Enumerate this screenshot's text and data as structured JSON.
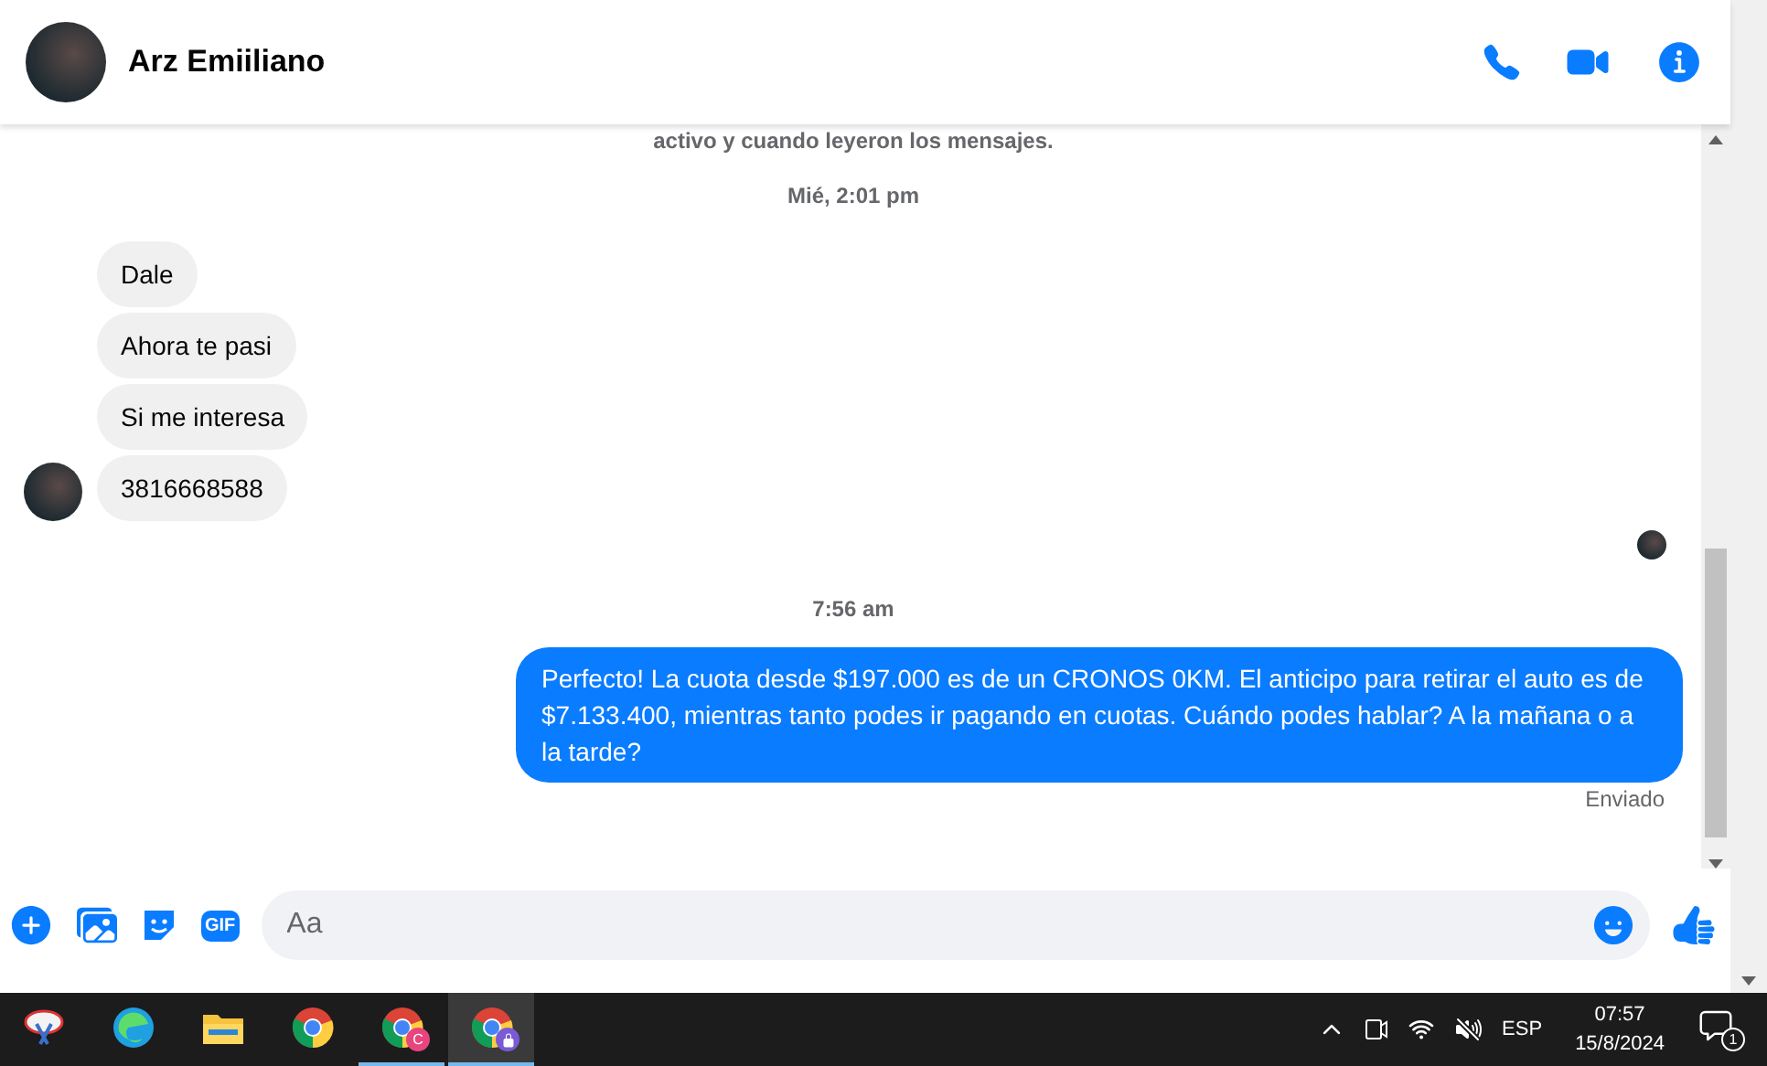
{
  "conversation": {
    "name": "Arz Emiiliano"
  },
  "messages": [
    {
      "kind": "notice",
      "text": "activo y cuando leyeron los mensajes."
    },
    {
      "kind": "time",
      "text": "Mié, 2:01 pm"
    },
    {
      "kind": "received",
      "text": "Dale",
      "avatar": false
    },
    {
      "kind": "received",
      "text": "Ahora te pasi",
      "avatar": false
    },
    {
      "kind": "received",
      "text": "Si me interesa",
      "avatar": false
    },
    {
      "kind": "received",
      "text": "3816668588",
      "avatar": true
    },
    {
      "kind": "seen"
    },
    {
      "kind": "time",
      "text": "7:56 am"
    },
    {
      "kind": "sent",
      "text": "Perfecto! La cuota desde $197.000 es de un CRONOS 0KM. El anticipo para retirar el auto es de $7.133.400, mientras tanto podes ir pagando en cuotas. Cuándo podes hablar? A la mañana o a la tarde?"
    },
    {
      "kind": "status",
      "text": "Enviado"
    }
  ],
  "composer": {
    "gif_label": "GIF",
    "placeholder": "Aa"
  },
  "taskbar": {
    "apps": [
      {
        "kind": "snip",
        "selected": false,
        "running": false
      },
      {
        "kind": "edge",
        "selected": false,
        "running": false
      },
      {
        "kind": "folder",
        "selected": false,
        "running": false
      },
      {
        "kind": "chrome",
        "selected": false,
        "running": false
      },
      {
        "kind": "chrome-c",
        "selected": false,
        "running": true,
        "badge": "C"
      },
      {
        "kind": "chrome-lock",
        "selected": true,
        "running": true
      }
    ],
    "language": "ESP",
    "time": "07:57",
    "date": "15/8/2024",
    "notifications": "1"
  }
}
